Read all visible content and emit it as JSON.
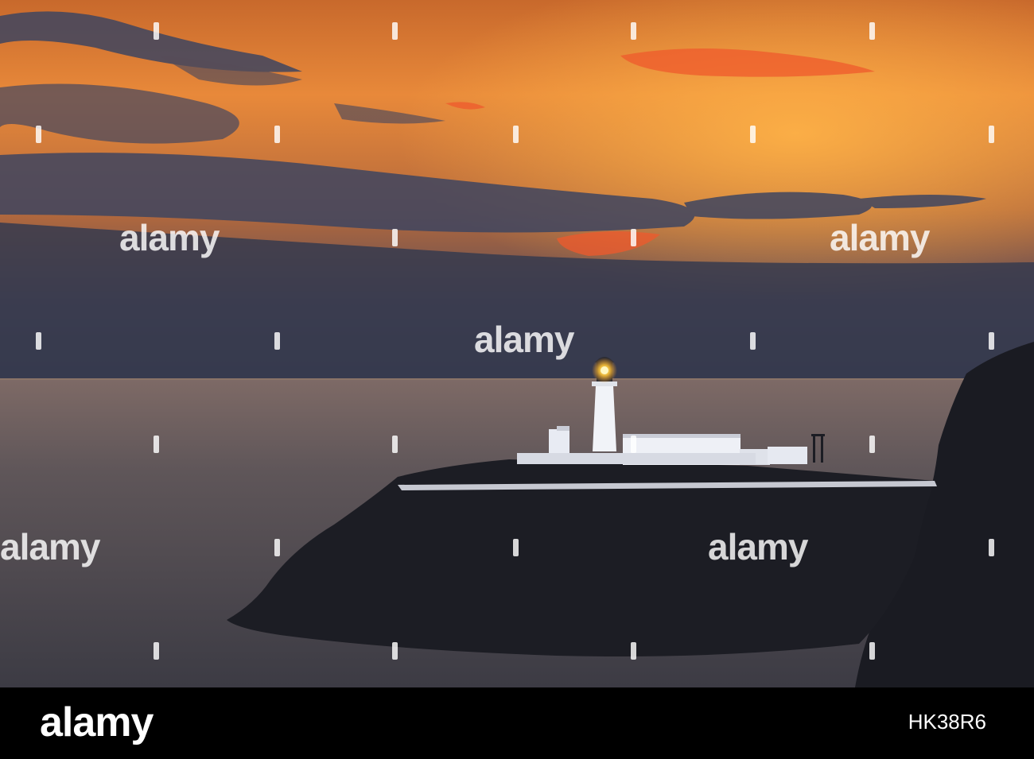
{
  "watermark": {
    "text": "alamy"
  },
  "footer": {
    "logo": "alamy",
    "image_id": "HK38R6"
  },
  "colors": {
    "sky_top": "#c8692c",
    "sky_glow": "#f6a43e",
    "cloud_dark": "#3e4560",
    "sea": "#4a4850",
    "rock": "#1c1d24",
    "lamp": "#ffd23a",
    "footer_bg": "#000000"
  }
}
